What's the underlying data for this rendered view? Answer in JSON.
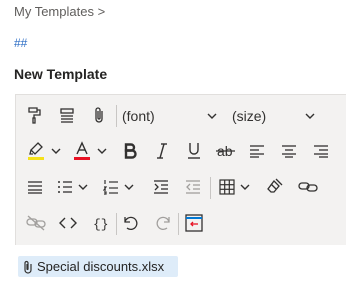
{
  "breadcrumb": {
    "label": "My Templates >"
  },
  "hash_link": "##",
  "template": {
    "title": "New Template"
  },
  "toolbar": {
    "font_dropdown": "(font)",
    "size_dropdown": "(size)",
    "buttons": [
      "format-painter",
      "paragraph-format",
      "insert-attachment",
      "highlight",
      "font-color",
      "bold",
      "italic",
      "underline",
      "strikethrough",
      "align-left",
      "align-center",
      "align-right",
      "justify",
      "bullets",
      "numbering",
      "increase-indent",
      "decrease-indent",
      "insert-table",
      "clear-formatting",
      "insert-link",
      "remove-link",
      "code",
      "braces",
      "undo",
      "redo",
      "insert-template"
    ],
    "colors": {
      "highlight": "#f5e11a",
      "font_color": "#e81123",
      "accent": "#0078d4"
    }
  },
  "attachment": {
    "name": "Special discounts.xlsx"
  }
}
